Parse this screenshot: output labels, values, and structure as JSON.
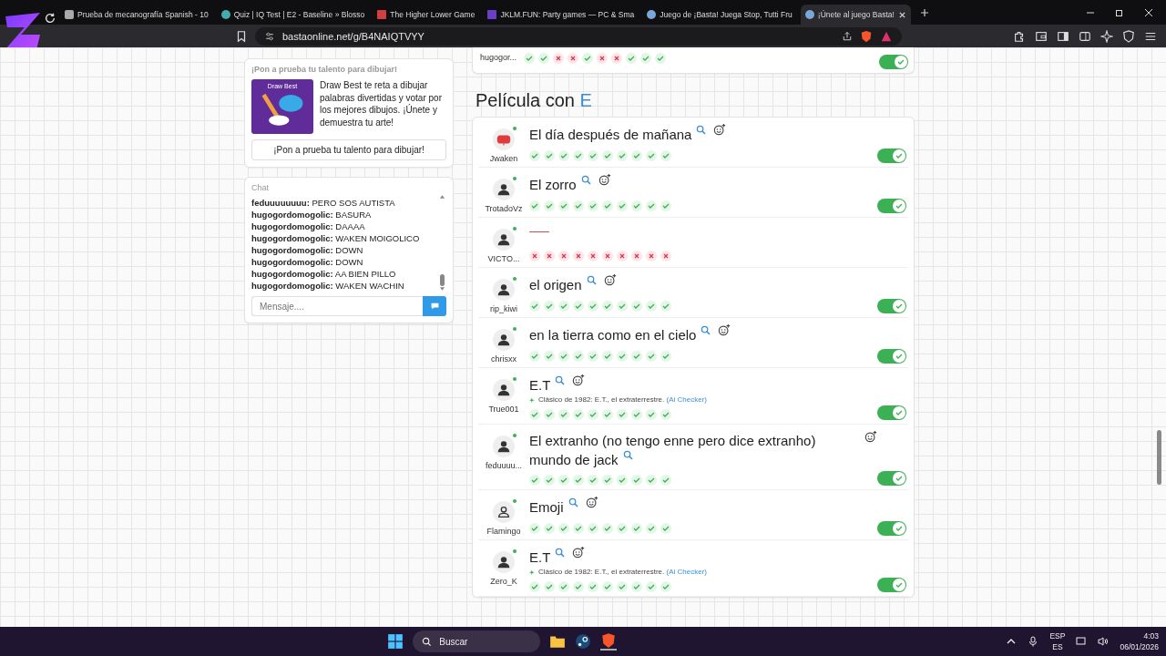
{
  "browser": {
    "tabs": [
      {
        "title": "Prueba de mecanografía Spanish - 10",
        "selected": false,
        "kind": "keys"
      },
      {
        "title": "Quiz | IQ Test | E2 - Baseline » Blosso",
        "selected": false,
        "kind": "leaf"
      },
      {
        "title": "The Higher Lower Game",
        "selected": false,
        "kind": "arrows"
      },
      {
        "title": "JKLM.FUN: Party games — PC & Sma",
        "selected": false,
        "kind": "square"
      },
      {
        "title": "Juego de ¡Basta! Juega Stop, Tutti Fru",
        "selected": false,
        "kind": "globe"
      },
      {
        "title": "¡Únete al juego Basta!",
        "selected": true,
        "kind": "globe"
      }
    ],
    "url": "bastaonline.net/g/B4NAIQTVYY"
  },
  "promo": {
    "heading": "¡Pon a prueba tu talento para dibujar!",
    "image_title": "Draw Best",
    "text": "Draw Best te reta a dibujar palabras divertidas y votar por los mejores dibujos. ¡Únete y demuestra tu arte!",
    "button": "¡Pon a prueba tu talento para dibujar!"
  },
  "chat": {
    "title": "Chat",
    "messages": [
      {
        "user": "feduuuuuuuu:",
        "text": "PERO SOS AUTISTA"
      },
      {
        "user": "hugogordomogolic:",
        "text": "BASURA"
      },
      {
        "user": "hugogordomogolic:",
        "text": "DAAAA"
      },
      {
        "user": "hugogordomogolic:",
        "text": "WAKEN MOIGOLICO"
      },
      {
        "user": "hugogordomogolic:",
        "text": "DOWN"
      },
      {
        "user": "hugogordomogolic:",
        "text": "DOWN"
      },
      {
        "user": "hugogordomogolic:",
        "text": "AA BIEN PILLO"
      },
      {
        "user": "hugogordomogolic:",
        "text": "WAKEN WACHIN"
      }
    ],
    "placeholder": "Mensaje...."
  },
  "previous_row": {
    "player": "hugogor...",
    "votes": [
      true,
      true,
      false,
      false,
      true,
      false,
      false,
      true,
      true,
      true
    ],
    "approved": true
  },
  "category": {
    "label": "Película con",
    "letter": "E"
  },
  "answers": [
    {
      "player": "Jwaken",
      "kind": "stop",
      "online": true,
      "answer": "El día después de mañana",
      "votes": [
        true,
        true,
        true,
        true,
        true,
        true,
        true,
        true,
        true,
        true
      ],
      "approved": true
    },
    {
      "player": "TrotadoVz",
      "kind": "person",
      "online": true,
      "answer": "El zorro",
      "votes": [
        true,
        true,
        true,
        true,
        true,
        true,
        true,
        true,
        true,
        true
      ],
      "approved": true
    },
    {
      "player": "VICTO...",
      "kind": "person",
      "online": true,
      "votes": [
        false,
        false,
        false,
        false,
        false,
        false,
        false,
        false,
        false,
        false
      ],
      "approved": false
    },
    {
      "player": "rip_kiwi",
      "kind": "person",
      "online": true,
      "answer": "el origen",
      "votes": [
        true,
        true,
        true,
        true,
        true,
        true,
        true,
        true,
        true,
        true
      ],
      "approved": true
    },
    {
      "player": "chrisxx",
      "kind": "person",
      "online": true,
      "answer": "en la tierra como en el cielo",
      "votes": [
        true,
        true,
        true,
        true,
        true,
        true,
        true,
        true,
        true,
        true
      ],
      "approved": true
    },
    {
      "player": "True001",
      "kind": "person",
      "online": true,
      "answer": "E.T",
      "note": "Clásico de 1982: E.T., el extraterrestre.",
      "note_source": "(Ai Checker)",
      "votes": [
        true,
        true,
        true,
        true,
        true,
        true,
        true,
        true,
        true,
        true
      ],
      "approved": true
    },
    {
      "player": "feduuuu...",
      "kind": "person",
      "online": true,
      "answer": "El extranho (no tengo enne pero dice extranho) mundo de jack",
      "votes": [
        true,
        true,
        true,
        true,
        true,
        true,
        true,
        true,
        true,
        true
      ],
      "approved": true
    },
    {
      "player": "Flamingo",
      "kind": "outline",
      "online": true,
      "answer": "Emoji",
      "votes": [
        true,
        true,
        true,
        true,
        true,
        true,
        true,
        true,
        true,
        true
      ],
      "approved": true
    },
    {
      "player": "Zero_K",
      "kind": "person",
      "online": true,
      "answer": "E.T",
      "note": "Clásico de 1982: E.T., el extraterrestre.",
      "note_source": "(Ai Checker)",
      "votes": [
        true,
        true,
        true,
        true,
        true,
        true,
        true,
        true,
        true,
        true
      ],
      "approved": true
    }
  ],
  "taskbar": {
    "search": "Buscar",
    "language": "ESP",
    "layout": "ES",
    "time": "4:03",
    "date": "06/01/2026"
  }
}
